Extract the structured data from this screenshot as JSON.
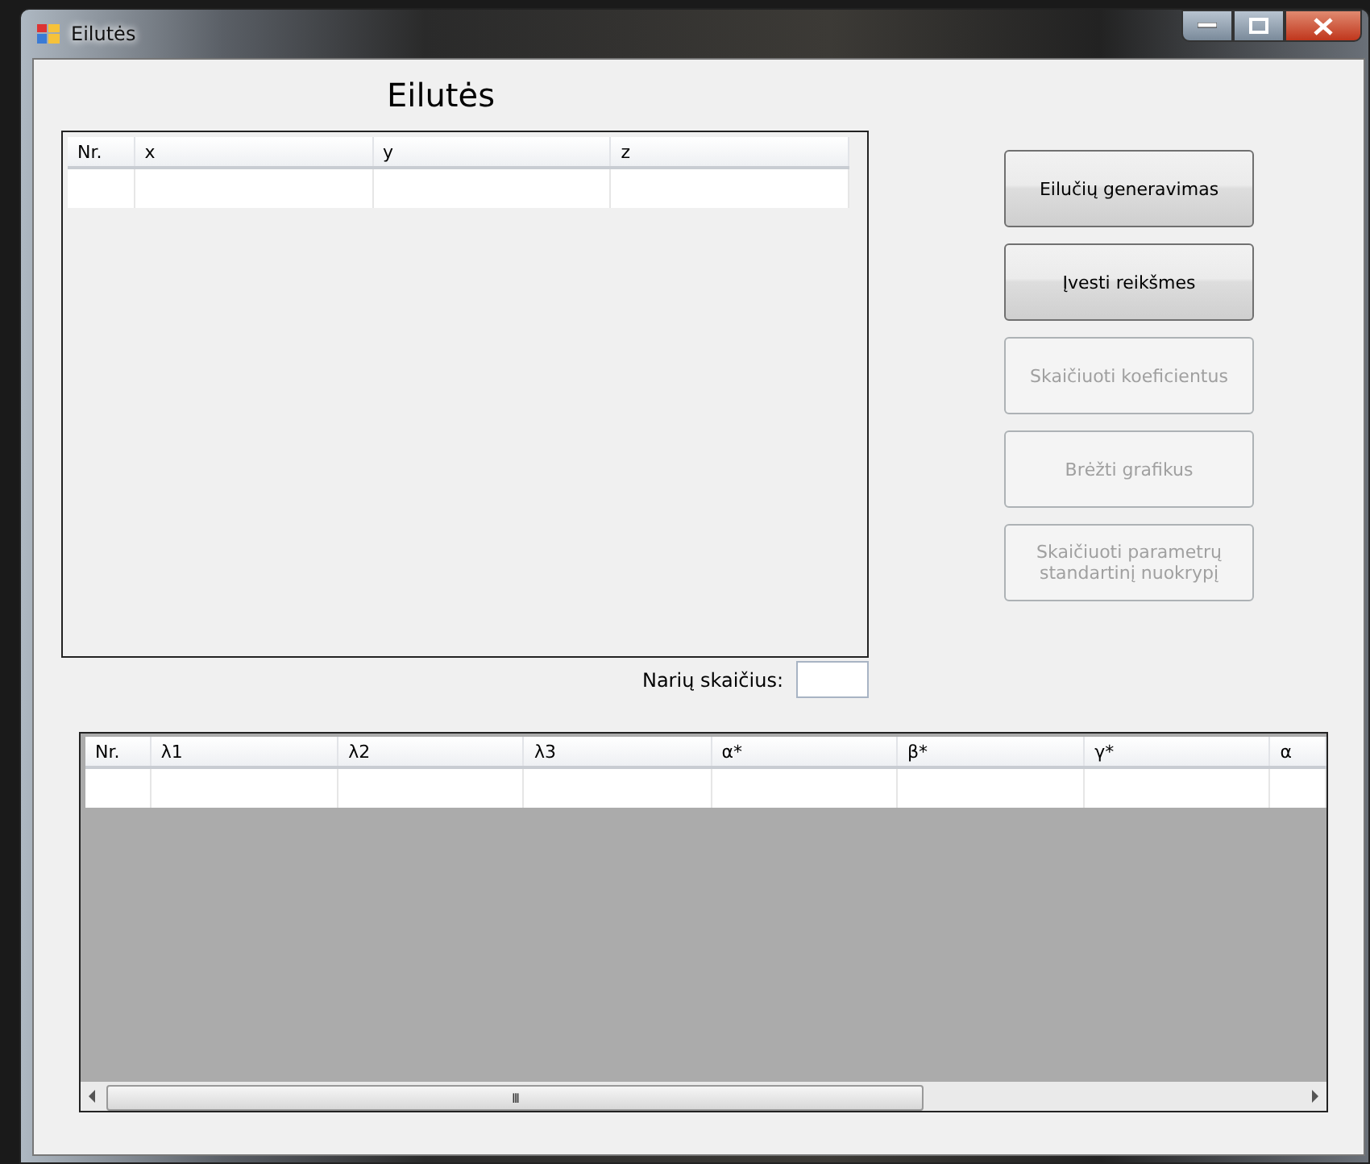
{
  "window": {
    "title": "Eilutės"
  },
  "heading": "Eilutės",
  "top_table": {
    "columns": [
      "Nr.",
      "x",
      "y",
      "z"
    ],
    "rows": [
      [
        "",
        "",
        "",
        ""
      ]
    ]
  },
  "buttons": [
    {
      "label": "Eilučių generavimas",
      "disabled": false
    },
    {
      "label": "Įvesti reikšmes",
      "disabled": false
    },
    {
      "label": "Skaičiuoti koeficientus",
      "disabled": true
    },
    {
      "label": "Brėžti grafikus",
      "disabled": true
    },
    {
      "label": "Skaičiuoti parametrų standartinį nuokrypį",
      "disabled": true
    }
  ],
  "count_field": {
    "label": "Narių skaičius:"
  },
  "bottom_table": {
    "columns": [
      "Nr.",
      "λ1",
      "λ2",
      "λ3",
      "α*",
      "β*",
      "γ*",
      "α"
    ],
    "rows": [
      [
        "",
        "",
        "",
        "",
        "",
        "",
        "",
        ""
      ]
    ],
    "scroll_thumb": "III"
  }
}
